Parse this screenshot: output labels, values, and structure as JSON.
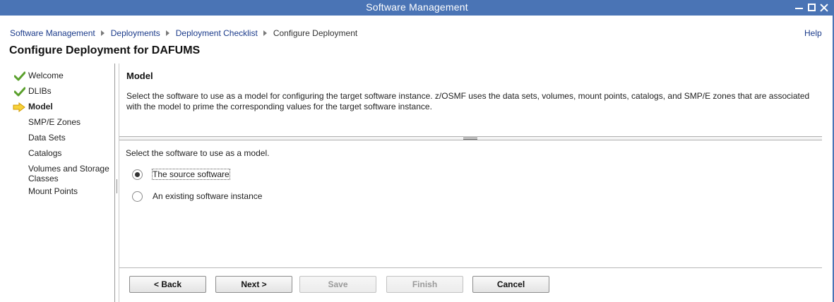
{
  "window": {
    "title": "Software Management"
  },
  "breadcrumb": {
    "items": [
      "Software Management",
      "Deployments",
      "Deployment Checklist"
    ],
    "current": "Configure Deployment"
  },
  "help_label": "Help",
  "page_title": "Configure Deployment for DAFUMS",
  "steps": [
    {
      "label": "Welcome",
      "status": "complete",
      "icon": "check-icon"
    },
    {
      "label": "DLIBs",
      "status": "complete",
      "icon": "check-icon"
    },
    {
      "label": "Model",
      "status": "current",
      "icon": "arrow-right-icon"
    },
    {
      "label": "SMP/E Zones",
      "status": "pending"
    },
    {
      "label": "Data Sets",
      "status": "pending"
    },
    {
      "label": "Catalogs",
      "status": "pending"
    },
    {
      "label": "Volumes and Storage Classes",
      "status": "pending"
    },
    {
      "label": "Mount Points",
      "status": "pending"
    }
  ],
  "section": {
    "title": "Model",
    "description": "Select the software to use as a model for configuring the target software instance.  z/OSMF uses the data sets, volumes, mount points, catalogs, and SMP/E zones that are associated with the model to prime the corresponding values for the target software instance."
  },
  "form": {
    "prompt": "Select the software to use as a model.",
    "options": [
      {
        "label": "The source software",
        "selected": true
      },
      {
        "label": "An existing software instance",
        "selected": false
      }
    ]
  },
  "buttons": {
    "back": "< Back",
    "next": "Next >",
    "save": "Save",
    "finish": "Finish",
    "cancel": "Cancel"
  },
  "colors": {
    "titlebar": "#4a74b5",
    "link": "#1a3a8a",
    "check": "#5aa02c",
    "arrow": "#f0b400"
  }
}
